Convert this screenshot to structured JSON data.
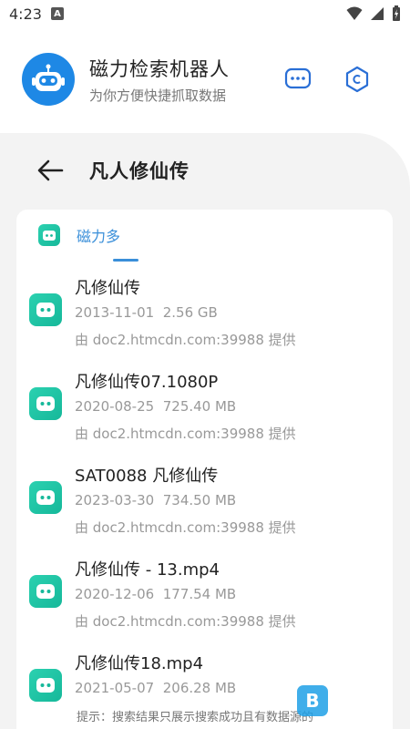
{
  "status_bar": {
    "time": "4:23",
    "a_badge": "A"
  },
  "app": {
    "title": "磁力检索机器人",
    "subtitle": "为你方便快捷抓取数据",
    "menu_icon": "chat-dots-icon",
    "settings_icon": "hexagon-icon",
    "accent": "#1e88e5"
  },
  "page": {
    "back_icon": "arrow-left-icon",
    "title": "凡人修仙传"
  },
  "tabs": [
    {
      "label": "磁力多",
      "active": true,
      "accent": "#3a8fd9"
    }
  ],
  "results": [
    {
      "name": "凡修仙传",
      "date": "2013-11-01",
      "size": "2.56 GB",
      "source": "由 doc2.htmcdn.com:39988 提供"
    },
    {
      "name": "凡修仙传07.1080P",
      "date": "2020-08-25",
      "size": "725.40 MB",
      "source": "由 doc2.htmcdn.com:39988 提供"
    },
    {
      "name": "SAT0088 凡修仙传",
      "date": "2023-03-30",
      "size": "734.50 MB",
      "source": "由 doc2.htmcdn.com:39988 提供"
    },
    {
      "name": "凡修仙传 - 13.mp4",
      "date": "2020-12-06",
      "size": "177.54 MB",
      "source": "由 doc2.htmcdn.com:39988 提供"
    },
    {
      "name": "凡修仙传18.mp4",
      "date": "2021-05-07",
      "size": "206.28 MB",
      "source": ""
    }
  ],
  "footer": {
    "hint": "提示：搜索结果只展示搜索成功且有数据源的"
  }
}
